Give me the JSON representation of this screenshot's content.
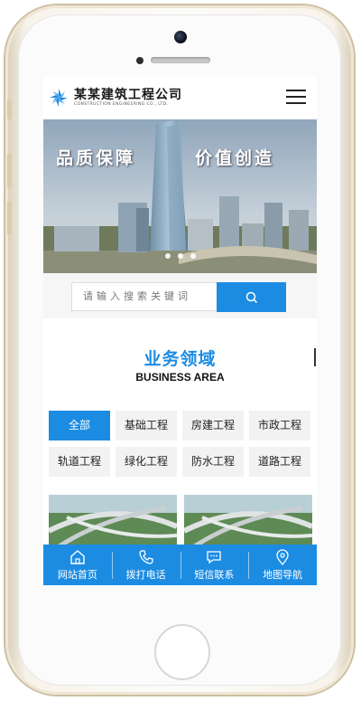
{
  "header": {
    "company_cn": "某某建筑工程公司",
    "company_en": "CONSTRUCTION ENGINEERING CO., LTD."
  },
  "banner": {
    "left_text": "品质保障",
    "right_text": "价值创造",
    "slides": 3
  },
  "search": {
    "placeholder": "请输入搜索关键词",
    "icon": "search-icon"
  },
  "section": {
    "title_cn": "业务领域",
    "title_en": "BUSINESS AREA"
  },
  "categories": [
    {
      "label": "全部",
      "active": true
    },
    {
      "label": "基础工程",
      "active": false
    },
    {
      "label": "房建工程",
      "active": false
    },
    {
      "label": "市政工程",
      "active": false
    },
    {
      "label": "轨道工程",
      "active": false
    },
    {
      "label": "绿化工程",
      "active": false
    },
    {
      "label": "防水工程",
      "active": false
    },
    {
      "label": "道路工程",
      "active": false
    }
  ],
  "bottom_nav": [
    {
      "label": "网站首页",
      "icon": "home-icon"
    },
    {
      "label": "拨打电话",
      "icon": "phone-icon"
    },
    {
      "label": "短信联系",
      "icon": "message-icon"
    },
    {
      "label": "地图导航",
      "icon": "map-pin-icon"
    }
  ],
  "colors": {
    "accent": "#1c8ce3",
    "tag_bg": "#f2f2f2"
  }
}
